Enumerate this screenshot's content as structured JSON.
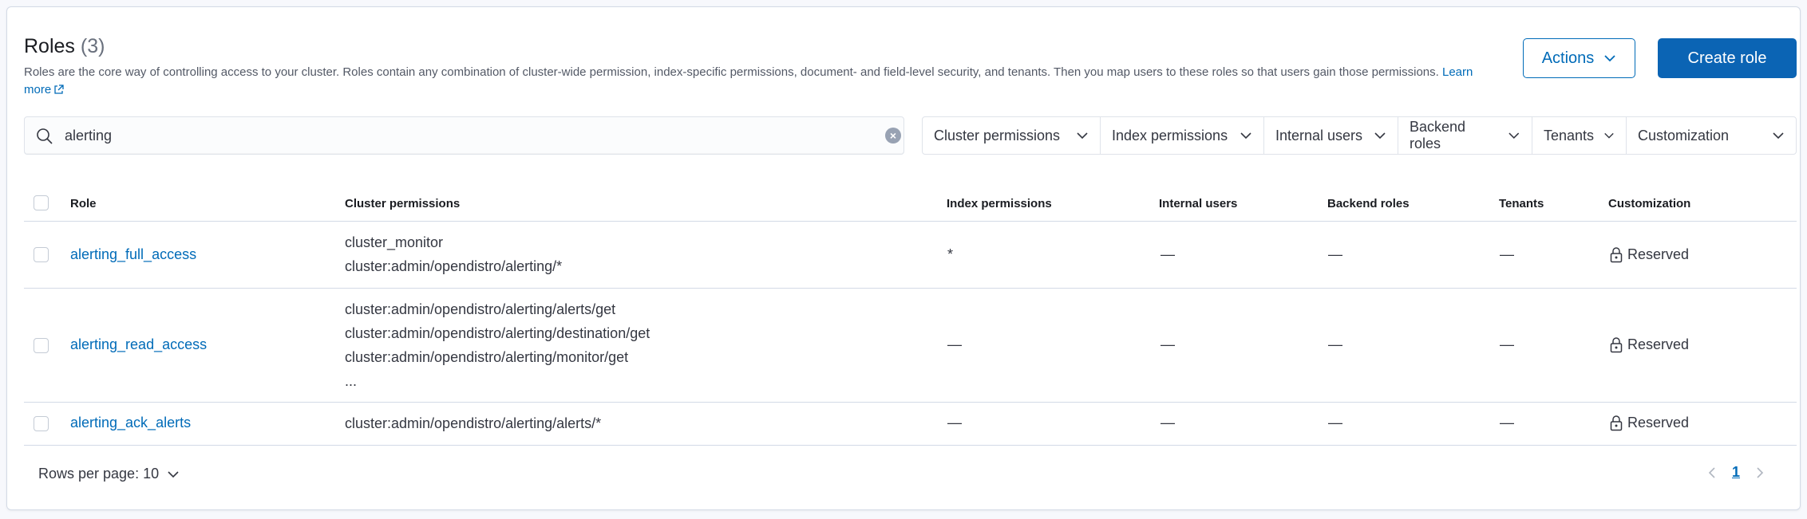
{
  "header": {
    "title": "Roles",
    "count": "(3)",
    "description": "Roles are the core way of controlling access to your cluster. Roles contain any combination of cluster-wide permission, index-specific permissions, document- and field-level security, and tenants. Then you map users to these roles so that users gain those permissions.",
    "learn_more": "Learn more",
    "actions_label": "Actions",
    "create_label": "Create role"
  },
  "search": {
    "value": "alerting",
    "placeholder": ""
  },
  "filters": [
    "Cluster permissions",
    "Index permissions",
    "Internal users",
    "Backend roles",
    "Tenants",
    "Customization"
  ],
  "table": {
    "columns": [
      "Role",
      "Cluster permissions",
      "Index permissions",
      "Internal users",
      "Backend roles",
      "Tenants",
      "Customization"
    ],
    "rows": [
      {
        "role": "alerting_full_access",
        "cluster_permissions": [
          "cluster_monitor",
          "cluster:admin/opendistro/alerting/*"
        ],
        "index_permissions": "*",
        "internal_users": "—",
        "backend_roles": "—",
        "tenants": "—",
        "customization": "Reserved"
      },
      {
        "role": "alerting_read_access",
        "cluster_permissions": [
          "cluster:admin/opendistro/alerting/alerts/get",
          "cluster:admin/opendistro/alerting/destination/get",
          "cluster:admin/opendistro/alerting/monitor/get",
          "..."
        ],
        "index_permissions": "—",
        "internal_users": "—",
        "backend_roles": "—",
        "tenants": "—",
        "customization": "Reserved"
      },
      {
        "role": "alerting_ack_alerts",
        "cluster_permissions": [
          "cluster:admin/opendistro/alerting/alerts/*"
        ],
        "index_permissions": "—",
        "internal_users": "—",
        "backend_roles": "—",
        "tenants": "—",
        "customization": "Reserved"
      }
    ]
  },
  "pagination": {
    "rows_per_page": "Rows per page: 10",
    "current_page": "1"
  },
  "colors": {
    "accent": "#006bb8",
    "primary_button": "#0b64b4",
    "border": "#d3dae6"
  },
  "icons": [
    "external-link-icon",
    "chevron-down-icon",
    "search-icon",
    "clear-icon",
    "lock-icon",
    "chevron-left-icon",
    "chevron-right-icon"
  ]
}
